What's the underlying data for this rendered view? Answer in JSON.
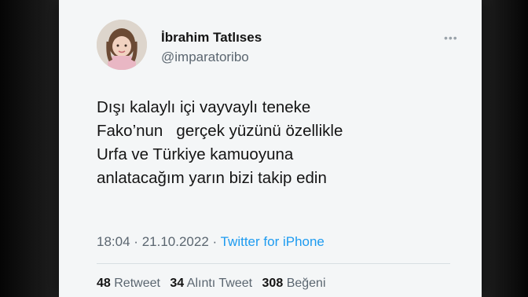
{
  "author": {
    "name": "İbrahim Tatlıses",
    "handle": "@imparatoribo"
  },
  "tweet": {
    "lines": [
      "Dışı kalaylı içi vayvaylı teneke",
      "Fako’nun   gerçek yüzünü özellikle",
      "Urfa ve Türkiye kamuoyuna",
      "anlatacağım yarın bizi takip edin"
    ]
  },
  "meta": {
    "time": "18:04",
    "date": "21.10.2022",
    "separator": "·",
    "source": "Twitter for iPhone"
  },
  "stats": {
    "retweets_count": "48",
    "retweets_label": "Retweet",
    "quotes_count": "34",
    "quotes_label": "Alıntı Tweet",
    "likes_count": "308",
    "likes_label": "Beğeni"
  },
  "icons": {
    "more": "more-icon"
  },
  "colors": {
    "link": "#1d9bf0",
    "text": "#141414",
    "muted": "#5b6670"
  }
}
